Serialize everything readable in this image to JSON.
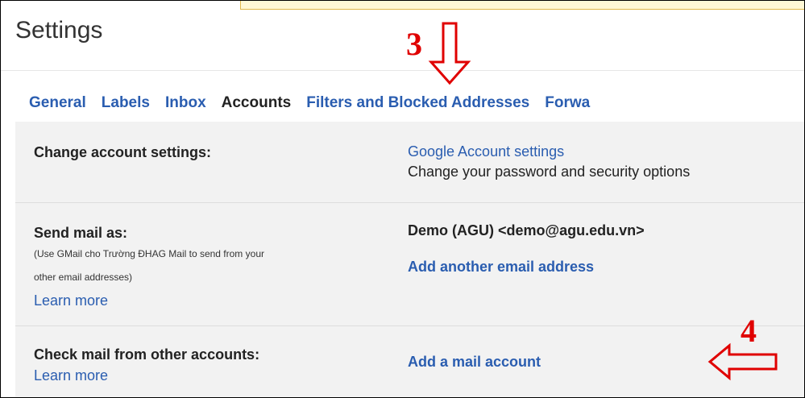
{
  "page_title": "Settings",
  "tabs": [
    {
      "label": "General",
      "active": false
    },
    {
      "label": "Labels",
      "active": false
    },
    {
      "label": "Inbox",
      "active": false
    },
    {
      "label": "Accounts",
      "active": true
    },
    {
      "label": "Filters and Blocked Addresses",
      "active": false
    },
    {
      "label": "Forwa",
      "active": false
    }
  ],
  "rows": {
    "change_account": {
      "label": "Change account settings:",
      "link": "Google Account settings",
      "description": "Change your password and security options"
    },
    "send_mail_as": {
      "label": "Send mail as:",
      "note_line1": "(Use GMail cho Trường ĐHAG Mail to send from your",
      "note_line2": "other email addresses)",
      "learn_more": "Learn more",
      "address": "Demo (AGU) <demo@agu.edu.vn>",
      "add_link": "Add another email address"
    },
    "check_mail": {
      "label": "Check mail from other accounts:",
      "learn_more": "Learn more",
      "add_link": "Add a mail account"
    }
  },
  "annotations": {
    "marker_3": "3",
    "marker_4": "4",
    "arrow_color": "#e00000"
  },
  "colors": {
    "link": "#2a5db0",
    "panel_bg": "#f2f2f2",
    "tooltip_bg": "#fff8d6"
  }
}
